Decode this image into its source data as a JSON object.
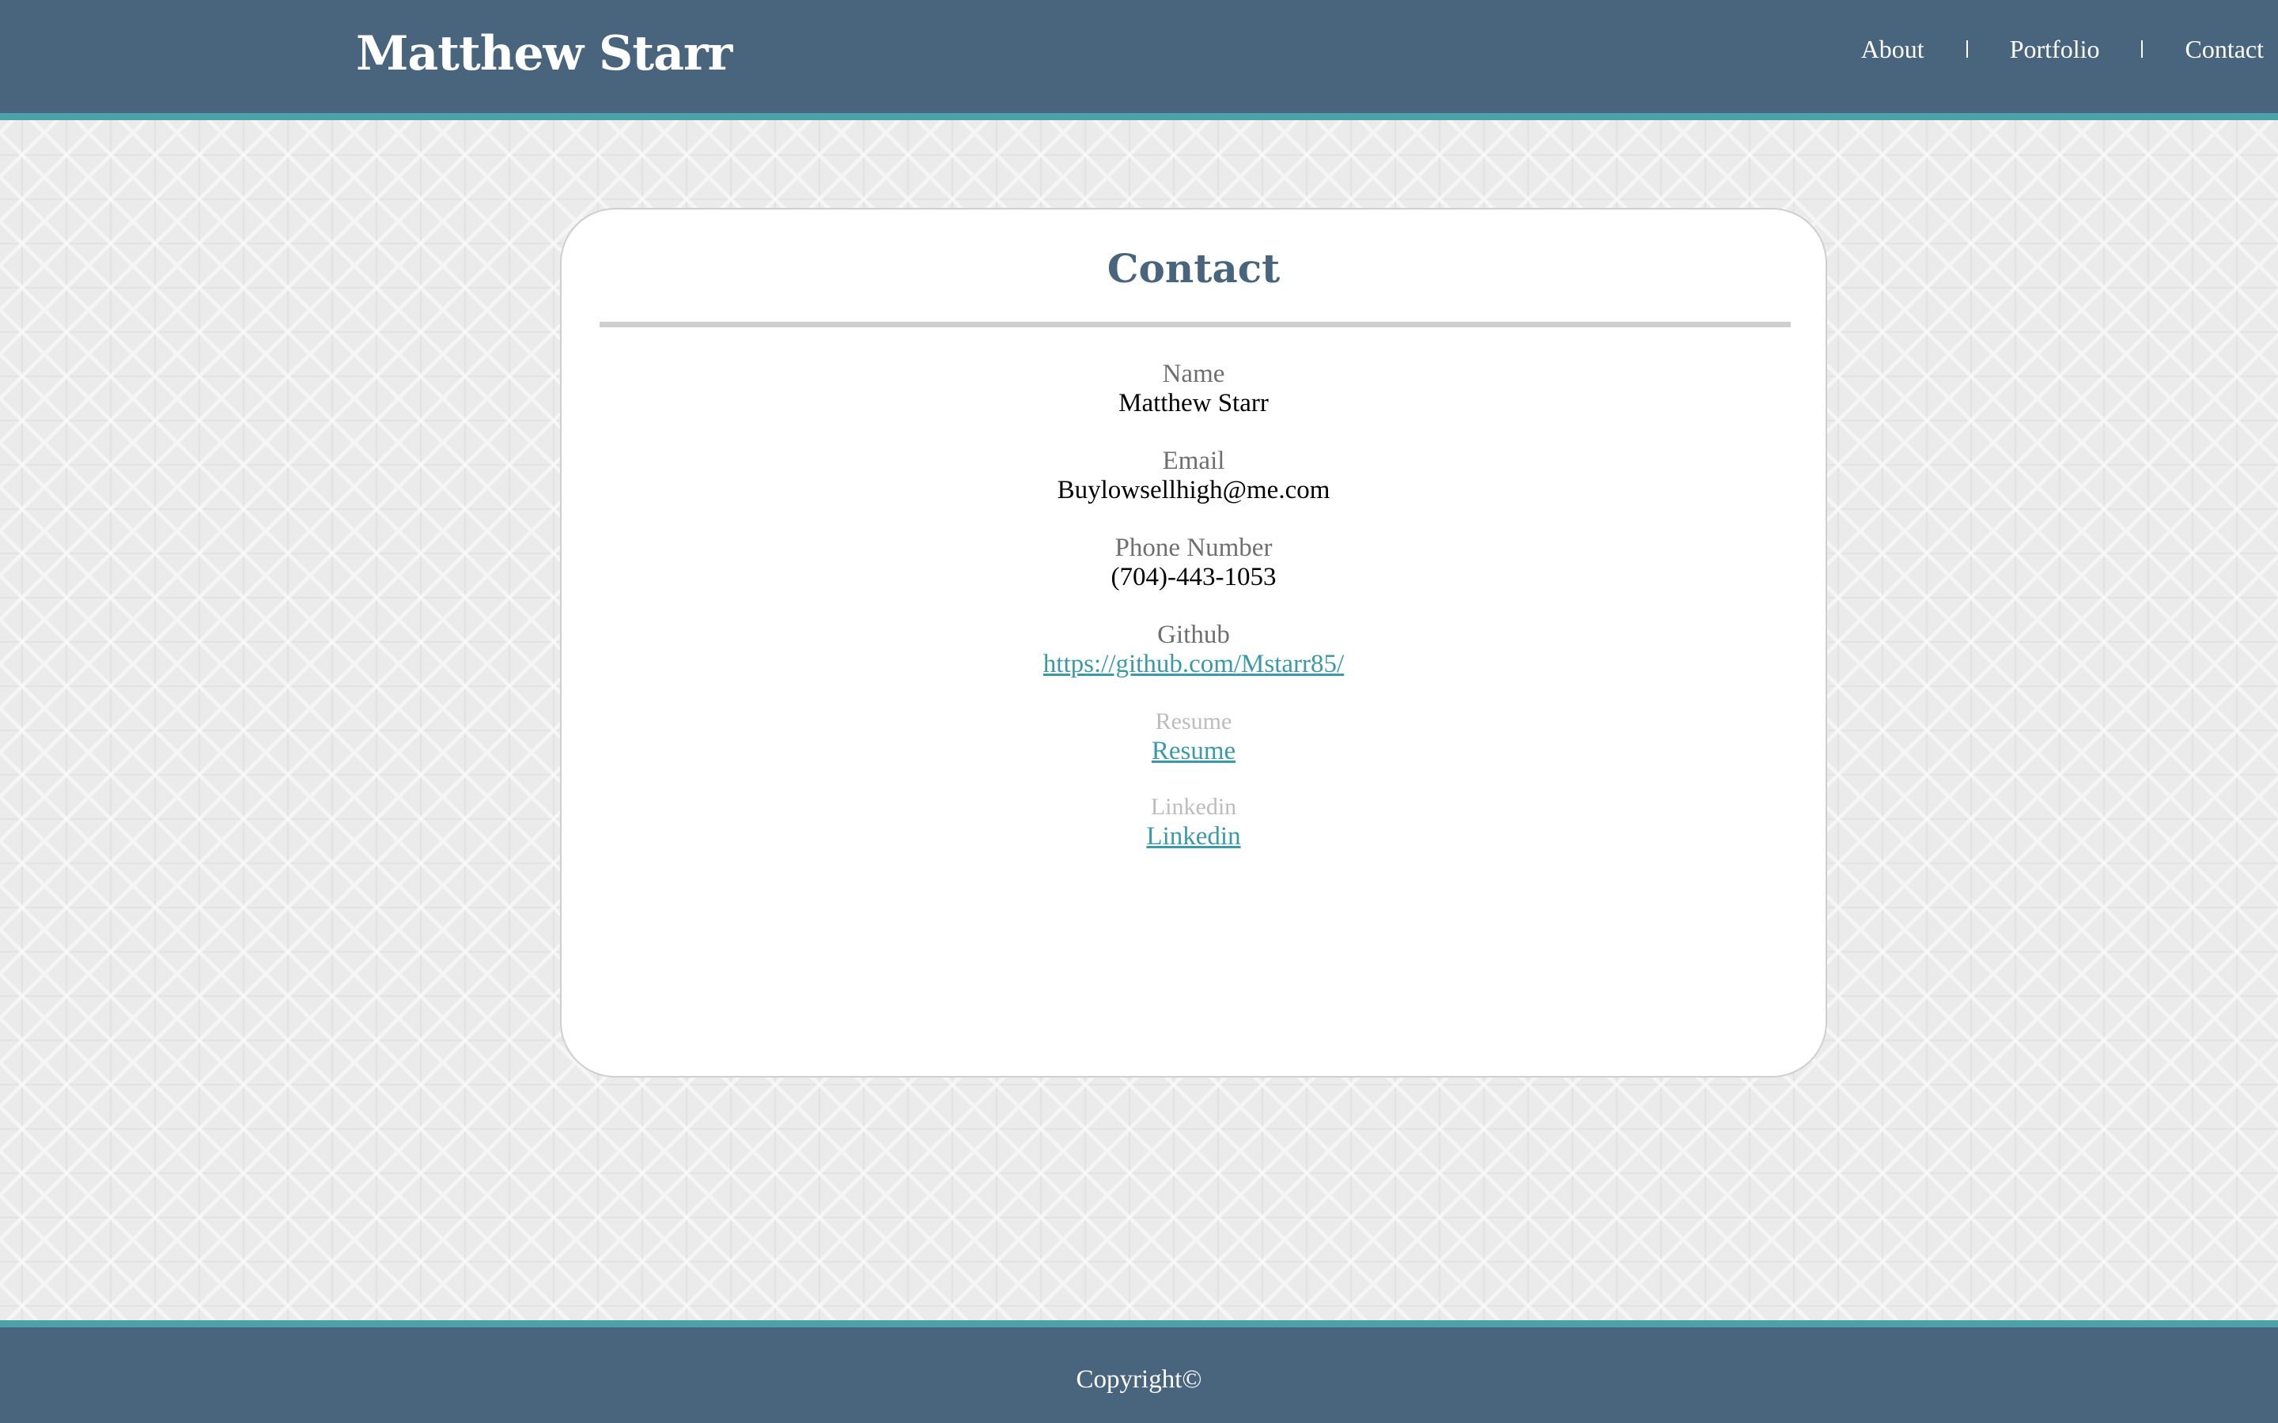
{
  "header": {
    "brand": "Matthew Starr",
    "nav": [
      {
        "label": "About"
      },
      {
        "label": "Portfolio"
      },
      {
        "label": "Contact"
      }
    ]
  },
  "contact": {
    "title": "Contact",
    "fields": [
      {
        "label": "Name",
        "value": "Matthew Starr"
      },
      {
        "label": "Email",
        "value": "Buylowsellhigh@me.com"
      },
      {
        "label": "Phone Number",
        "value": "(704)-443-1053"
      },
      {
        "label": "Github",
        "value": "https://github.com/Mstarr85/"
      },
      {
        "label": "Resume",
        "value": "Resume"
      },
      {
        "label": "Linkedin",
        "value": "Linkedin"
      }
    ]
  },
  "footer": {
    "copyright": "Copyright©"
  },
  "colors": {
    "header_bg": "#49657d",
    "accent": "#4aa3ab",
    "link": "#3a9aa6",
    "title": "#49657d"
  }
}
